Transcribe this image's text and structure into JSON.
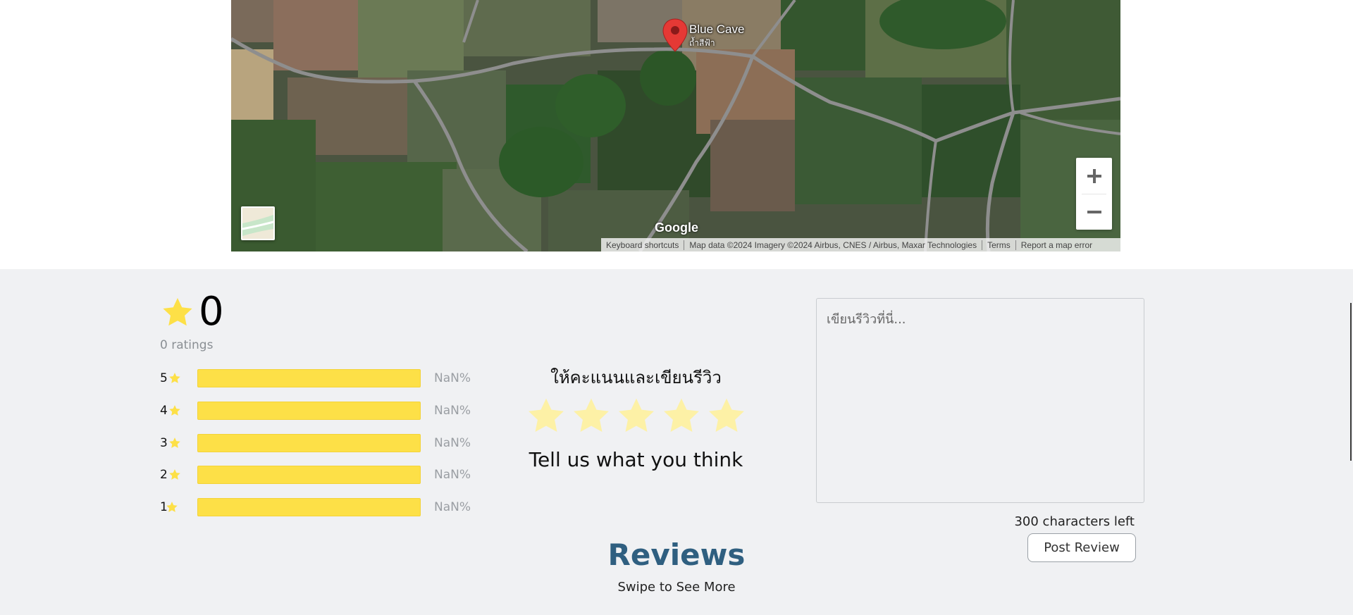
{
  "map": {
    "place_name": "Blue Cave",
    "place_subtitle": "ถ้ำสีฟ้า",
    "zoom_in_label": "+",
    "zoom_out_label": "−",
    "google_label": "Google",
    "attribution": {
      "keyboard_shortcuts": "Keyboard shortcuts",
      "map_data": "Map data ©2024 Imagery ©2024 Airbus, CNES / Airbus, Maxar Technologies",
      "terms": "Terms",
      "report_error": "Report a map error"
    },
    "icons": {
      "marker": "map-pin-icon",
      "layer": "map-layer-icon"
    }
  },
  "summary": {
    "average": "0",
    "ratings_count": "0 ratings",
    "breakdown": [
      {
        "stars": "5",
        "percent": "NaN%"
      },
      {
        "stars": "4",
        "percent": "NaN%"
      },
      {
        "stars": "3",
        "percent": "NaN%"
      },
      {
        "stars": "2",
        "percent": "NaN%"
      },
      {
        "stars": "1",
        "percent": "NaN%"
      }
    ]
  },
  "rate": {
    "heading": "ให้คะแนนและเขียนรีวิว",
    "subheading": "Tell us what you think",
    "star_count": 5
  },
  "review_form": {
    "placeholder": "เขียนรีวิวที่นี่...",
    "chars_left": "300 characters left",
    "post_label": "Post Review"
  },
  "reviews": {
    "title": "Reviews",
    "hint": "Swipe to See More"
  },
  "colors": {
    "star": "#fde047",
    "star_light": "#fdf1a6",
    "reviews_title": "#2f5f80",
    "section_bg": "#f0f1f3",
    "marker": "#e53935"
  }
}
